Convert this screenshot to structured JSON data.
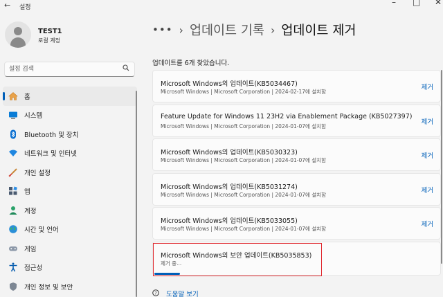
{
  "titlebar": {
    "app_title": "설정",
    "back_glyph": "←",
    "minimize_glyph": "–",
    "maximize_glyph": "□",
    "close_glyph": "✕"
  },
  "profile": {
    "name": "TEST1",
    "account_type": "로컬 계정"
  },
  "search": {
    "placeholder": "설정 검색",
    "icon": "search-icon"
  },
  "sidebar": {
    "items": [
      {
        "label": "홈",
        "icon": "home-icon",
        "active": true
      },
      {
        "label": "시스템",
        "icon": "system-icon"
      },
      {
        "label": "Bluetooth 및 장치",
        "icon": "bluetooth-icon"
      },
      {
        "label": "네트워크 및 인터넷",
        "icon": "network-icon"
      },
      {
        "label": "개인 설정",
        "icon": "brush-icon"
      },
      {
        "label": "앱",
        "icon": "apps-icon"
      },
      {
        "label": "계정",
        "icon": "account-icon"
      },
      {
        "label": "시간 및 언어",
        "icon": "globe-icon"
      },
      {
        "label": "게임",
        "icon": "gamepad-icon"
      },
      {
        "label": "접근성",
        "icon": "accessibility-icon"
      },
      {
        "label": "개인 정보 및 보안",
        "icon": "shield-icon"
      }
    ]
  },
  "breadcrumb": {
    "more": "•••",
    "separator": "›",
    "parent": "업데이트 기록",
    "current": "업데이트 제거"
  },
  "main": {
    "count_text": "업데이트를 6개 찾았습니다.",
    "remove_label": "제거",
    "updates": [
      {
        "title": "Microsoft Windows의 업데이트(KB5034467)",
        "meta": "Microsoft Windows  |  Microsoft Corporation  |  2024-02-17에 설치함"
      },
      {
        "title": "Feature Update for Windows 11 23H2 via Enablement Package (KB5027397)",
        "meta": "Microsoft Windows  |  Microsoft Corporation  |  2024-01-07에 설치함"
      },
      {
        "title": "Microsoft Windows의 업데이트(KB5030323)",
        "meta": "Microsoft Windows  |  Microsoft Corporation  |  2024-01-07에 설치함"
      },
      {
        "title": "Microsoft Windows의 업데이트(KB5031274)",
        "meta": "Microsoft Windows  |  Microsoft Corporation  |  2024-01-07에 설치함"
      },
      {
        "title": "Microsoft Windows의 업데이트(KB5033055)",
        "meta": "Microsoft Windows  |  Microsoft Corporation  |  2024-01-07에 설치함"
      }
    ],
    "removing": {
      "title": "Microsoft Windows의 보안 업데이트(KB5035853)",
      "status": "제거 중...",
      "progress_fraction": 0.09
    }
  },
  "help": {
    "label": "도움말 보기",
    "icon": "help-icon"
  },
  "colors": {
    "accent": "#005fb8",
    "highlight": "#e0282e",
    "background": "#f3f3f3"
  }
}
